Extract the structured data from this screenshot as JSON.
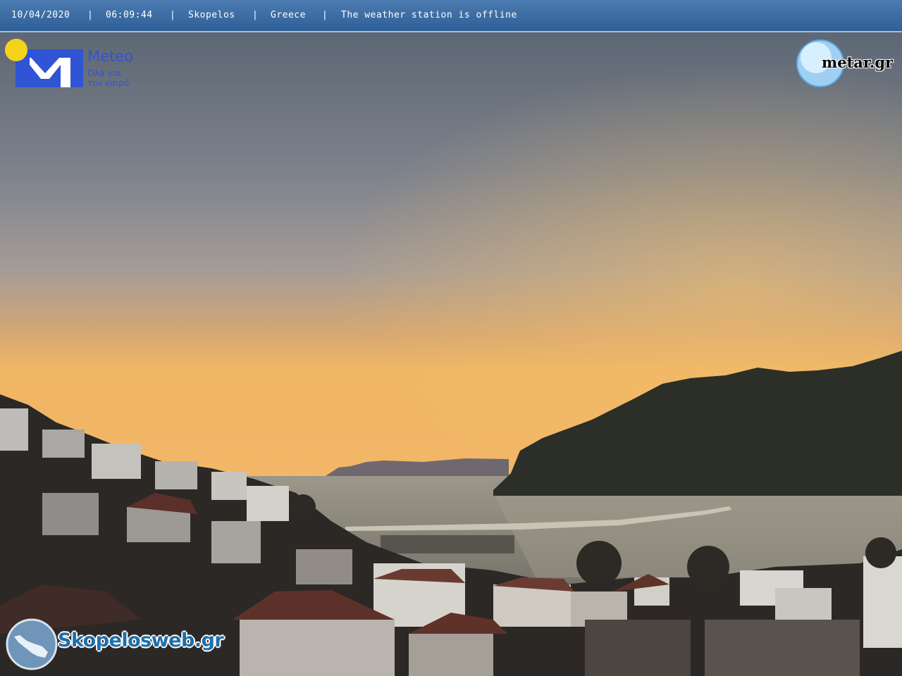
{
  "overlay": {
    "date": "10/04/2020",
    "time": "06:09:44",
    "location": "Skopelos",
    "country": "Greece",
    "status": "The weather station is offline",
    "separator": "|"
  },
  "logos": {
    "meteo": {
      "name": "Meteo",
      "tagline_line1": "Όλα για",
      "tagline_line2": "τον καιρό"
    },
    "metar": {
      "name": "metar.gr"
    },
    "skopelosweb": {
      "name": "Skopelosweb.gr"
    }
  },
  "colors": {
    "sky_top": "#5c6776",
    "sky_mid": "#8e8f97",
    "sky_glow": "#e8a55a",
    "horizon": "#f2b768",
    "mountain": "#2a2d25",
    "sea": "#8c8a7e",
    "town_dark": "#2b2826",
    "roof": "#5a2f28",
    "banner": "#3a6aa3",
    "meteo_blue": "#2f55d4",
    "sun_yellow": "#f5d31c"
  }
}
